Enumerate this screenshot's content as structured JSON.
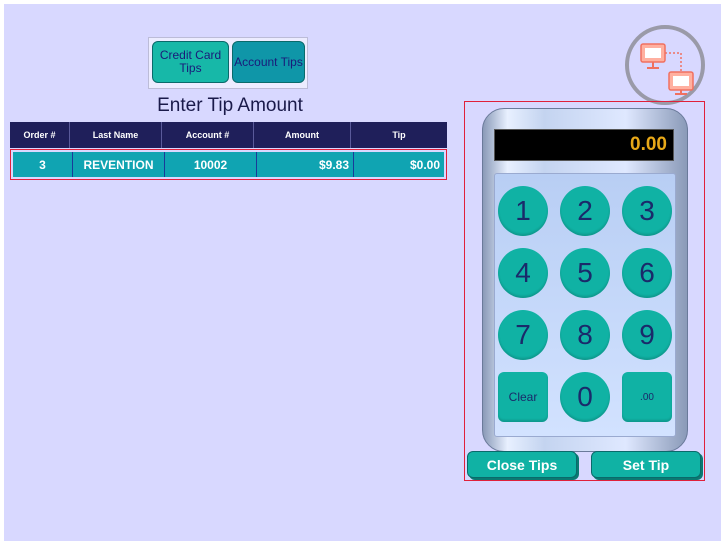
{
  "tabs": {
    "credit_card": "Credit Card Tips",
    "account": "Account Tips"
  },
  "page_title": "Enter Tip Amount",
  "table": {
    "headers": [
      "Order #",
      "Last Name",
      "Account #",
      "Amount",
      "Tip"
    ],
    "rows": [
      [
        "3",
        "REVENTION",
        "10002",
        "$9.83",
        "$0.00"
      ]
    ]
  },
  "calculator": {
    "display": "0.00",
    "keys": [
      "1",
      "2",
      "3",
      "4",
      "5",
      "6",
      "7",
      "8",
      "9",
      "Clear",
      "0",
      ".00"
    ]
  },
  "actions": {
    "close_tips": "Close Tips",
    "set_tip": "Set Tip"
  },
  "icons": {
    "connection": "network-connection-icon"
  },
  "colors": {
    "background": "#d8d8ff",
    "teal": "#10b2a4",
    "header_navy": "#1f1f5a",
    "display_text": "#e8a818",
    "highlight_border": "#e0203a"
  }
}
